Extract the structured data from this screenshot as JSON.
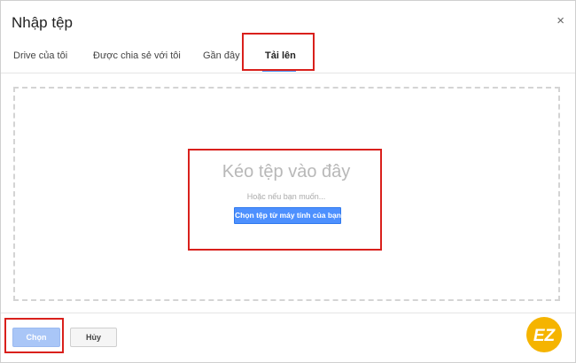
{
  "dialog": {
    "title": "Nhập tệp",
    "close_glyph": "×"
  },
  "tabs": [
    {
      "label": "Drive của tôi",
      "active": false
    },
    {
      "label": "Được chia sẻ với tôi",
      "active": false
    },
    {
      "label": "Gần đây",
      "active": false
    },
    {
      "label": "Tải lên",
      "active": true
    }
  ],
  "upload": {
    "drag_text": "Kéo tệp vào đây",
    "or_text": "Hoặc nếu bạn muốn...",
    "pick_button": "Chọn tệp từ máy tính của bạn"
  },
  "footer": {
    "select_label": "Chọn",
    "select_enabled": false,
    "cancel_label": "Hủy"
  },
  "logo": {
    "text": "EZ",
    "color": "#f5b400"
  },
  "colors": {
    "accent": "#4d90fe",
    "highlight": "#d9201c"
  }
}
